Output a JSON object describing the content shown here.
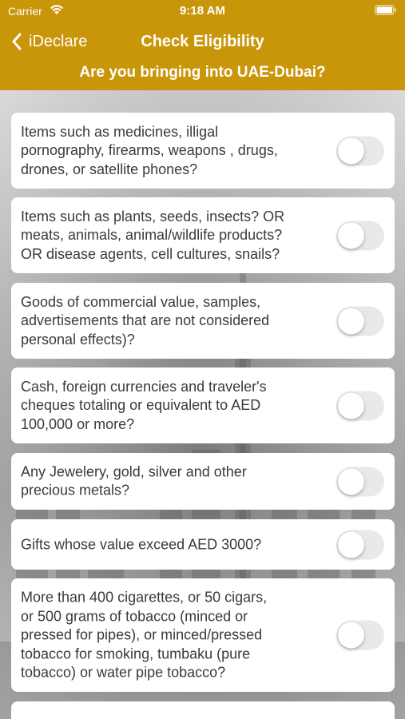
{
  "status_bar": {
    "carrier": "Carrier",
    "time": "9:18 AM"
  },
  "nav": {
    "back_label": "iDeclare",
    "title": "Check Eligibility"
  },
  "subtitle": "Are you bringing into UAE-Dubai?",
  "colors": {
    "header": "#c9960a",
    "toggle_off": "#e9e9ea",
    "card": "#ffffff"
  },
  "questions": [
    {
      "text": "Items such as medicines, illigal\npornography, firearms, weapons , drugs,\ndrones, or satellite phones?",
      "toggle_on": false
    },
    {
      "text": "Items such as plants, seeds, insects? OR\nmeats, animals, animal/wildlife products?\nOR disease agents, cell cultures, snails?",
      "toggle_on": false
    },
    {
      "text": "Goods of commercial value, samples,\nadvertisements that are not considered\npersonal effects)?",
      "toggle_on": false
    },
    {
      "text": "Cash, foreign currencies and traveler's\ncheques totaling or equivalent to AED\n100,000 or more?",
      "toggle_on": false
    },
    {
      "text": "Any Jewelery, gold, silver and other\nprecious metals?",
      "toggle_on": false
    },
    {
      "text": "Gifts whose value exceed AED 3000?",
      "toggle_on": false
    },
    {
      "text": "More than 400 cigarettes, or 50 cigars,\nor 500 grams of tobacco (minced or\npressed for pipes), or minced/pressed\ntobacco for smoking, tumbaku (pure\ntobacco) or water pipe tobacco?",
      "toggle_on": false
    }
  ]
}
